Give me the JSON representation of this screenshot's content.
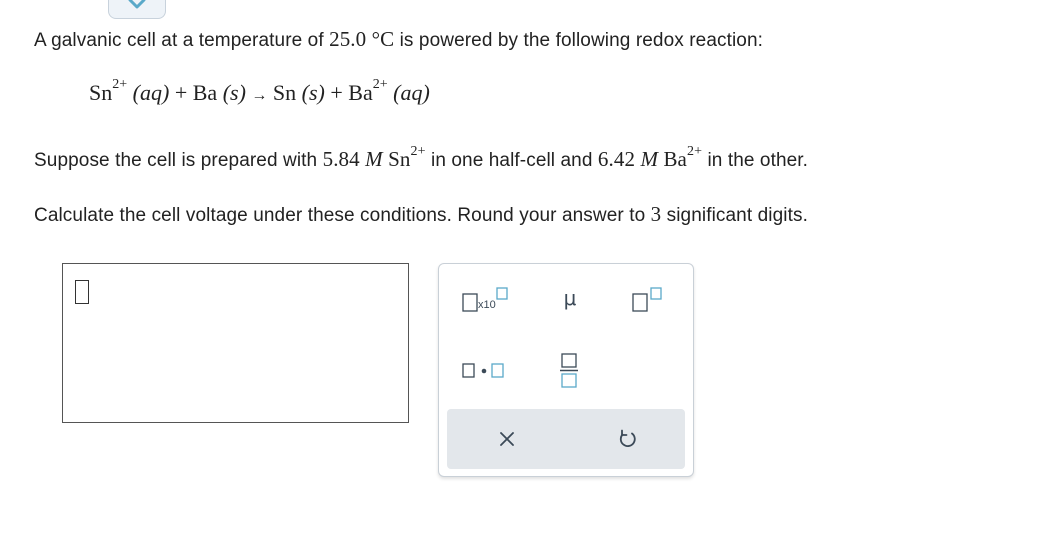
{
  "question": {
    "line1_text": "A galvanic cell at a temperature of",
    "line1_temp": "25.0 °C",
    "line1_tail": "is powered by the following redox reaction:",
    "equation": {
      "reactant1": "Sn",
      "reactant1_charge": "2+",
      "reactant1_state": "(aq)",
      "plus1": "+",
      "reactant2": "Ba",
      "reactant2_state": "(s)",
      "arrow": "→",
      "product1": "Sn",
      "product1_state": "(s)",
      "plus2": "+",
      "product2": "Ba",
      "product2_charge": "2+",
      "product2_state": "(aq)"
    },
    "line2_pre": "Suppose the cell is prepared with",
    "line2_conc1": "5.84",
    "line2_unit1": "M",
    "line2_ion1": "Sn",
    "line2_charge1": "2+",
    "line2_mid": "in one half-cell and",
    "line2_conc2": "6.42",
    "line2_unit2": "M",
    "line2_ion2": "Ba",
    "line2_charge2": "2+",
    "line2_tail": "in the other.",
    "line3_pre": "Calculate the cell voltage under these conditions. Round your answer to",
    "line3_digits": "3",
    "line3_tail": "significant digits."
  },
  "palette": {
    "x10_label": "x10",
    "mu_label": "μ",
    "clear_label": "×",
    "undo_label": "↺"
  },
  "icons": {
    "top_tab": "chevron-down-icon",
    "undo": "undo-icon",
    "clear": "close-icon"
  },
  "colors": {
    "accent": "#5aa9c9",
    "palette_bar": "#e3e7eb",
    "icon": "#3c4a58"
  }
}
